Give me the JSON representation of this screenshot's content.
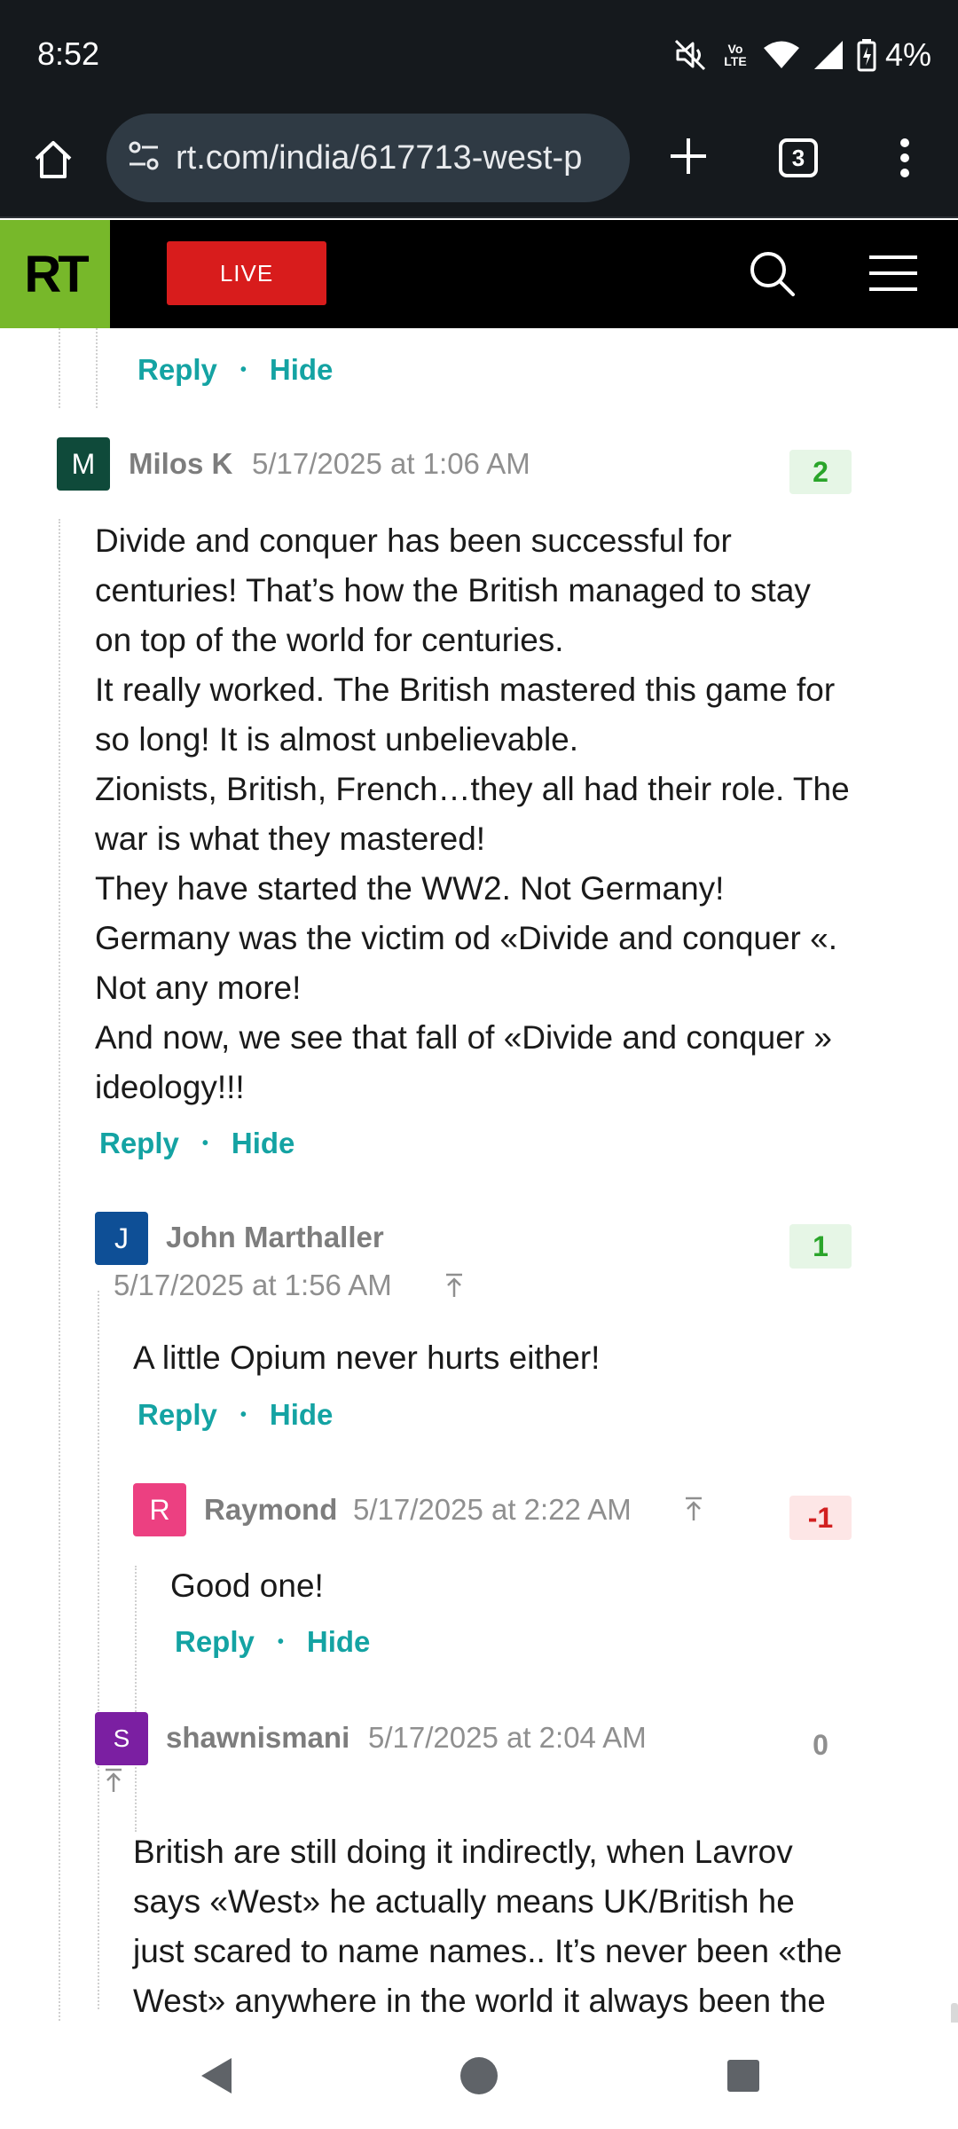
{
  "status_bar": {
    "time": "8:52",
    "lte_label": "Vo LTE",
    "battery_percent": "4%"
  },
  "browser": {
    "url": "rt.com/india/617713-west-p",
    "tab_count": "3"
  },
  "site": {
    "logo_text": "RT",
    "live_label": "LIVE"
  },
  "comments": {
    "actions": {
      "reply": "Reply",
      "hide": "Hide",
      "separator": "•"
    },
    "c1": {
      "initial": "M",
      "author": "Milos K",
      "date": "5/17/2025 at 1:06 AM",
      "votes": "2",
      "avatar_color": "#0f4a3a",
      "lines": [
        "Divide and conquer has been successful for",
        "centuries! That’s how the British managed to stay",
        "on top of the world for centuries.",
        "It really worked. The British mastered this game for",
        "so long! It is almost unbelievable.",
        "Zionists, British, French…they all had their role. The",
        "war is what they mastered!",
        "They have started the WW2. Not Germany!",
        "Germany was the victim od «Divide and conquer «.",
        "Not any more!",
        "And now, we see that fall of «Divide and conquer »",
        "ideology!!!"
      ]
    },
    "c2": {
      "initial": "J",
      "author": "John Marthaller",
      "date": "5/17/2025 at 1:56 AM",
      "votes": "1",
      "avatar_color": "#0e4f96",
      "text": "A little Opium never hurts either!"
    },
    "c3": {
      "initial": "R",
      "author": "Raymond",
      "date": "5/17/2025 at 2:22 AM",
      "votes": "-1",
      "avatar_color": "#ec4081",
      "text": "Good one!"
    },
    "c4": {
      "initial": "S",
      "author": "shawnismani",
      "date": "5/17/2025 at 2:04 AM",
      "votes": "0",
      "avatar_color": "#7b1fa2",
      "lines": [
        "British are still doing it indirectly, when Lavrov",
        "says «West» he actually means UK/British he",
        "just scared to name names.. It’s never been «the",
        "West» anywhere in the world it always been the"
      ]
    }
  },
  "colors": {
    "accent": "#14a3a3",
    "rt_green": "#77b82a",
    "live_red": "#d81c1c",
    "chrome_bg": "#15191d"
  }
}
